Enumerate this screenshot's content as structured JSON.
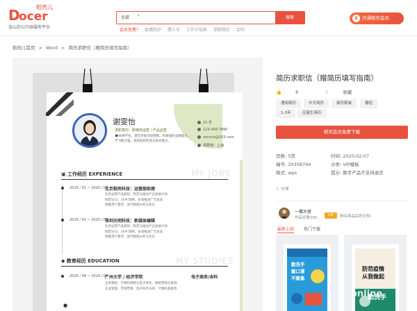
{
  "brand": {
    "logo_text": "Docer",
    "logo_cn": "稻壳儿",
    "tagline": "金山办公内容服务平台",
    "accent": "#e8523f"
  },
  "search": {
    "category": "全部",
    "button": "搜索",
    "hot_words": [
      "会员免费?",
      "疫情防护",
      "情人节",
      "工作计划表",
      "求职简历",
      "合同"
    ]
  },
  "header": {
    "vip_button": "开通稻壳会员",
    "vip_icon": "crown-icon"
  },
  "breadcrumb": [
    "稻壳儿首页",
    ">",
    "Word",
    ">",
    "简历求职信（赠简历填写指南）"
  ],
  "resume": {
    "name": "谢雯怡",
    "intent": "求职意向：新媒体运营 / 产品运营",
    "bio": "🎓本季学生，曾在开发活动营销，有很强的业绩能力，学习能力强，具有较好的语言表达能力。",
    "info": [
      "23 岁",
      "123-456-7890",
      "service@163.com",
      "现居地：上海"
    ],
    "sections": {
      "work": "工作经历 EXPERIENCE",
      "work_bg": "MY JOBS",
      "edu": "教育经历 EDUCATION",
      "edu_bg": "MY STUDIES"
    },
    "jobs": [
      {
        "date": "2019 / 01 ~ 2020 / 05",
        "title": "北京稻壳科技：运营部助理",
        "body": [
          "负责运营产品规划，制定与推动产品发展计划",
          "制定SEO、SEM 策略，协调推进广告投放",
          "搜集用户需求，进行数据分析与优化"
        ]
      },
      {
        "date": "2019 / 01 ~ 2020 / 05",
        "title": "深圳光明科技：新媒体编辑",
        "body": [
          "负责运营产品规划，制定与推动产品发展计划",
          "制定SEO、SEM 策略，协调推进广告投放",
          "搜集用户需求，进行数据分析与优化"
        ]
      }
    ],
    "edu": {
      "date": "2016 / 09 ~ 2019 / 06",
      "school": "广州大学 / 经济学院",
      "degree": "电子商务/本科",
      "body": [
        "主修课程：计算机网络与电子商务、网络营销与策划、",
        "企业管理、市场营销、电子商务法律、计算机基础等"
      ]
    }
  },
  "doc": {
    "title": "简历求职信（赠简历填写指南）",
    "likes": "8",
    "favorite": "收藏",
    "tags": [
      "通用简历",
      "中文简历",
      "简历套装",
      "春招",
      "1-3年",
      "应届生简历"
    ],
    "download": "稻壳会员免费下载",
    "meta": {
      "pages_label": "页数:",
      "pages": "5页",
      "time_label": "时间:",
      "time": "2020-02-07",
      "id_label": "编号:",
      "id": "20308794",
      "cat_label": "分类:",
      "cat": "VIP模板",
      "format_label": "格式:",
      "format": "wps",
      "tip_label": "提示:",
      "tip": "数字产品不支持退货"
    },
    "share": "分享"
  },
  "uploader": {
    "name": "一棵大荷",
    "count": "作品总数265",
    "badge": "VIP",
    "right": "购买商品后的文档"
  },
  "recommend": {
    "tabs": [
      "最新上线",
      "热门下载"
    ],
    "cards": [
      {
        "line1": "勤洗手",
        "line2": "戴口罩",
        "line3": "不聚集"
      },
      {
        "line1": "防范疫情",
        "line2": "从我做起",
        "line3": "勤洗手"
      }
    ]
  },
  "watermark": "online"
}
